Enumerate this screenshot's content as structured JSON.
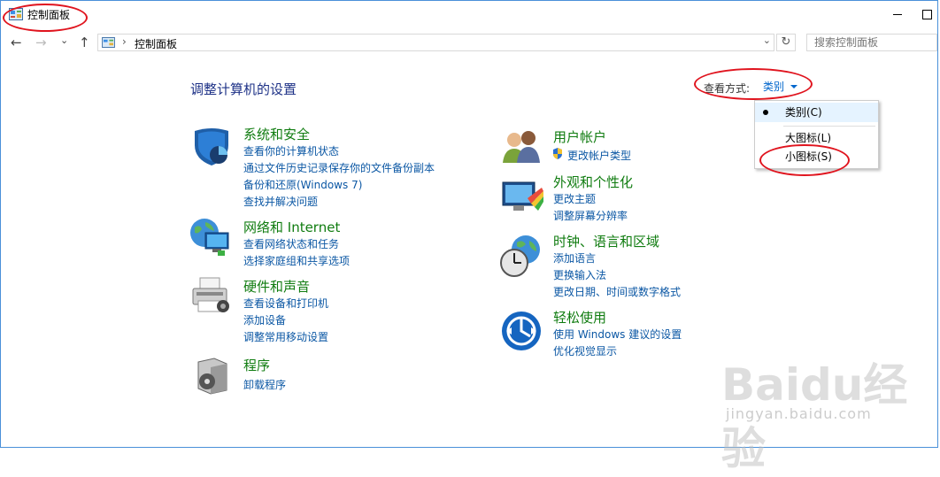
{
  "window": {
    "title": "控制面板"
  },
  "address": {
    "path": "控制面板",
    "separator": "›"
  },
  "nav": {
    "back": "←",
    "forward": "→",
    "recent": "⌄",
    "up": "↑",
    "refresh": "↻",
    "dropdown": "⌄"
  },
  "search": {
    "placeholder": "搜索控制面板"
  },
  "header": {
    "title": "调整计算机的设置"
  },
  "view": {
    "label": "查看方式:",
    "selected": "类别",
    "options": [
      "类别(C)",
      "大图标(L)",
      "小图标(S)"
    ]
  },
  "categories": {
    "system": {
      "title": "系统和安全",
      "links": [
        "查看你的计算机状态",
        "通过文件历史记录保存你的文件备份副本",
        "备份和还原(Windows 7)",
        "查找并解决问题"
      ]
    },
    "network": {
      "title": "网络和 Internet",
      "links": [
        "查看网络状态和任务",
        "选择家庭组和共享选项"
      ]
    },
    "hardware": {
      "title": "硬件和声音",
      "links": [
        "查看设备和打印机",
        "添加设备",
        "调整常用移动设置"
      ]
    },
    "programs": {
      "title": "程序",
      "links": [
        "卸载程序"
      ]
    },
    "users": {
      "title": "用户帐户",
      "links": [
        "更改帐户类型"
      ]
    },
    "appearance": {
      "title": "外观和个性化",
      "links": [
        "更改主题",
        "调整屏幕分辨率"
      ]
    },
    "clock": {
      "title": "时钟、语言和区域",
      "links": [
        "添加语言",
        "更换输入法",
        "更改日期、时间或数字格式"
      ]
    },
    "ease": {
      "title": "轻松使用",
      "links": [
        "使用 Windows 建议的设置",
        "优化视觉显示"
      ]
    }
  },
  "watermark": {
    "brand": "Baidu经验",
    "url": "jingyan.baidu.com"
  },
  "colors": {
    "title_blue": "#1e3287",
    "link_blue": "#0b57a4",
    "category_green": "#107c10",
    "annotation_red": "#e0141e"
  }
}
